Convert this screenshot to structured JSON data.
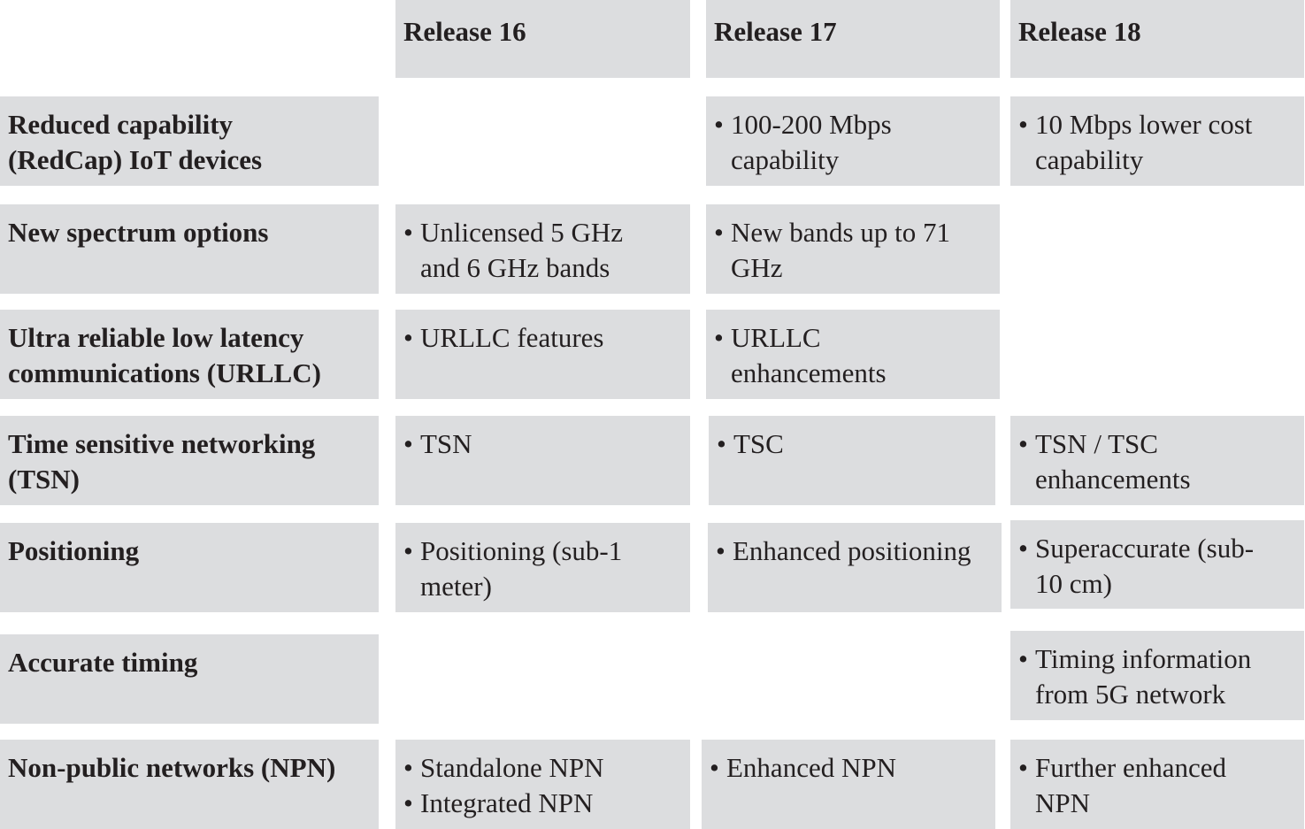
{
  "colors": {
    "cell_fill": "#dcdddf",
    "text": "#231f20",
    "background": "#ffffff"
  },
  "headers": [
    "Release 16",
    "Release 17",
    "Release 18"
  ],
  "rows": [
    {
      "label": "Reduced capability\n(RedCap) IoT devices",
      "r16": null,
      "r17": [
        "100-200 Mbps\ncapability"
      ],
      "r18": [
        "10 Mbps lower cost\ncapability"
      ]
    },
    {
      "label": "New spectrum options",
      "r16": [
        "Unlicensed 5 GHz\nand 6 GHz bands"
      ],
      "r17": [
        "New bands up to 71\nGHz"
      ],
      "r18": null
    },
    {
      "label": "Ultra reliable low latency\ncommunications (URLLC)",
      "r16": [
        "URLLC features"
      ],
      "r17": [
        "URLLC\nenhancements"
      ],
      "r18": null
    },
    {
      "label": "Time sensitive networking\n(TSN)",
      "r16": [
        "TSN"
      ],
      "r17": [
        "TSC"
      ],
      "r18": [
        "TSN / TSC\nenhancements"
      ]
    },
    {
      "label": "Positioning",
      "r16": [
        "Positioning (sub-1\nmeter)"
      ],
      "r17": [
        "Enhanced positioning"
      ],
      "r18": [
        "Superaccurate (sub-\n10 cm)"
      ]
    },
    {
      "label": "Accurate timing",
      "r16": null,
      "r17": null,
      "r18": [
        "Timing information\nfrom 5G network"
      ]
    },
    {
      "label": "Non-public networks (NPN)",
      "r16": [
        "Standalone NPN",
        "Integrated NPN"
      ],
      "r17": [
        "Enhanced NPN"
      ],
      "r18": [
        "Further enhanced\nNPN"
      ]
    }
  ],
  "bullet": "•"
}
